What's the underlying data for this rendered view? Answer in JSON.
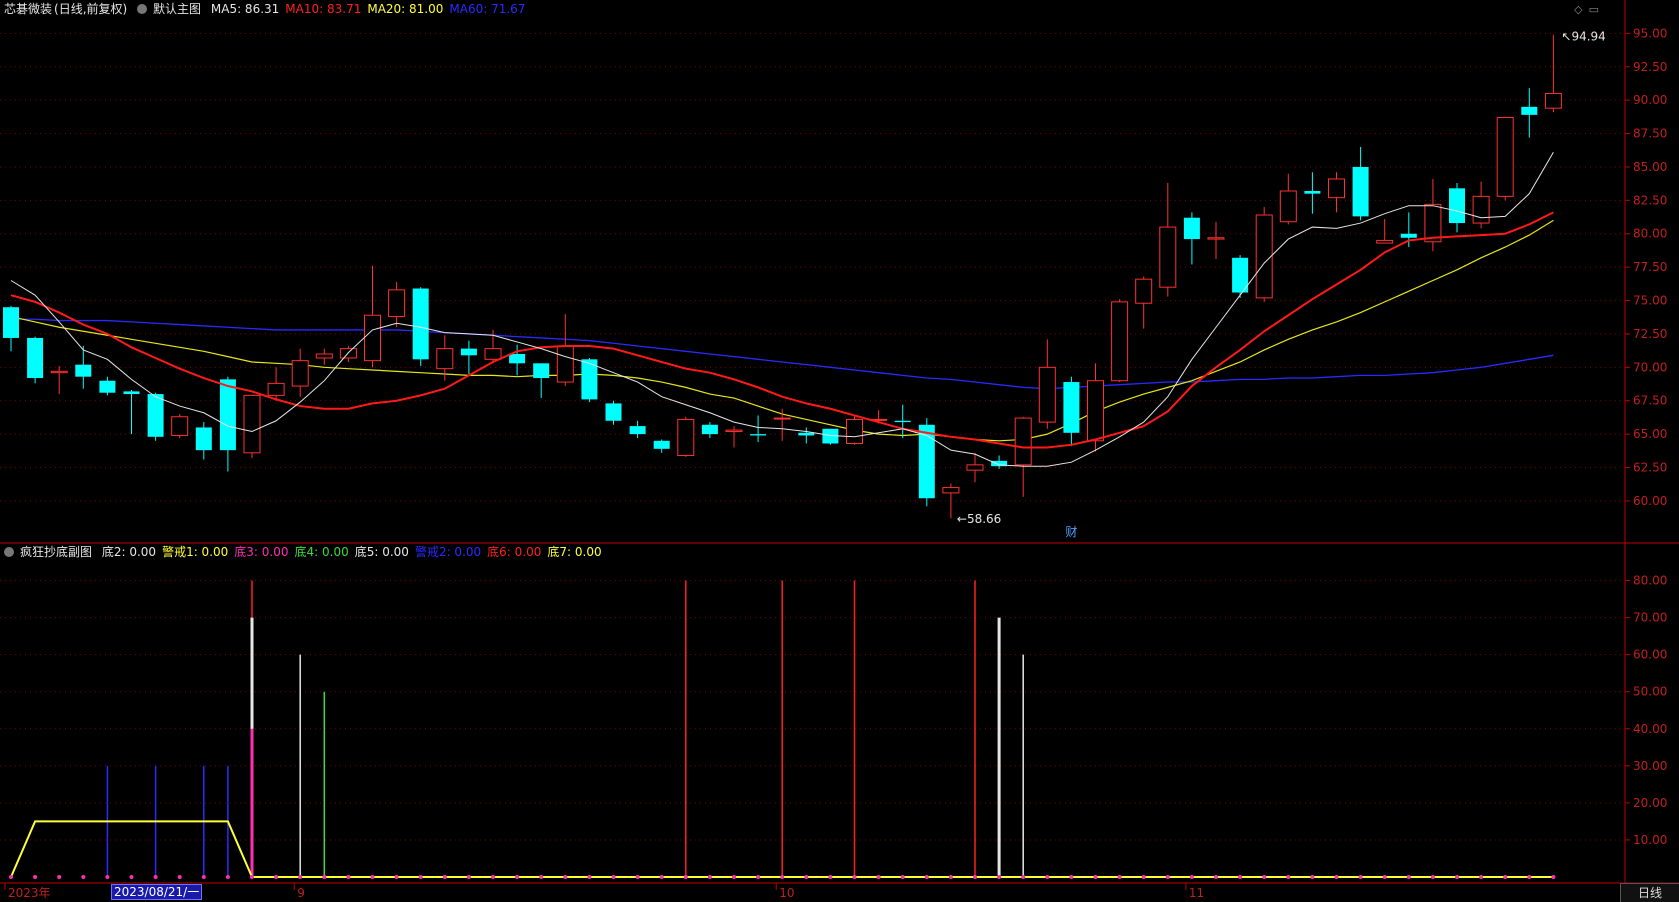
{
  "main_header": {
    "stock": "芯碁微装",
    "mode": "(日线,前复权)",
    "template": "默认主图",
    "ma_items": [
      {
        "label": "MA5: 86.31",
        "color": "#e6e6e6"
      },
      {
        "label": "MA10: 83.71",
        "color": "#ff2020"
      },
      {
        "label": "MA20: 81.00",
        "color": "#ffff3a"
      },
      {
        "label": "MA60: 71.67",
        "color": "#2a2aff"
      }
    ]
  },
  "sub_header": {
    "title": "疯狂抄底副图",
    "items": [
      {
        "label": "底2: 0.00",
        "color": "#e6e6e6"
      },
      {
        "label": "警戒1: 0.00",
        "color": "#ffff3a"
      },
      {
        "label": "底3: 0.00",
        "color": "#ff2fb4"
      },
      {
        "label": "底4: 0.00",
        "color": "#3adc3a"
      },
      {
        "label": "底5: 0.00",
        "color": "#e6e6e6"
      },
      {
        "label": "警戒2: 0.00",
        "color": "#2a2aff"
      },
      {
        "label": "底6: 0.00",
        "color": "#ff2020"
      },
      {
        "label": "底7: 0.00",
        "color": "#ffff3a"
      }
    ]
  },
  "annotations": {
    "high": "94.94",
    "low": "58.66",
    "marker": "财"
  },
  "x_axis": {
    "labels": [
      {
        "label": "2023年",
        "index": 0
      },
      {
        "label": "9",
        "index": 12
      },
      {
        "label": "10",
        "index": 32
      },
      {
        "label": "11",
        "index": 49
      }
    ],
    "cursor_date": "2023/08/21/一",
    "period": "日线"
  },
  "colors": {
    "up": "#ff3030",
    "down": "#00ffff",
    "axis": "#c00000",
    "grid": "#7a0000"
  },
  "chart_data": [
    {
      "type": "candlestick",
      "ylim": [
        57,
        96
      ],
      "yticks": [
        "95.00",
        "92.50",
        "90.00",
        "87.50",
        "85.00",
        "82.50",
        "80.00",
        "77.50",
        "75.00",
        "72.50",
        "70.00",
        "67.50",
        "65.00",
        "62.50",
        "60.00"
      ],
      "candles": [
        [
          74.5,
          72.2,
          74.6,
          71.2
        ],
        [
          72.2,
          69.2,
          72.3,
          68.8
        ],
        [
          69.6,
          69.7,
          70.1,
          68.0
        ],
        [
          70.2,
          69.3,
          71.6,
          68.4
        ],
        [
          69.0,
          68.1,
          69.3,
          67.9
        ],
        [
          68.2,
          68.0,
          68.3,
          65.0
        ],
        [
          68.0,
          64.8,
          68.1,
          64.5
        ],
        [
          64.9,
          66.3,
          66.5,
          64.7
        ],
        [
          65.5,
          63.8,
          65.9,
          63.1
        ],
        [
          69.1,
          63.8,
          69.3,
          62.2
        ],
        [
          63.6,
          67.9,
          67.9,
          63.2
        ],
        [
          67.9,
          68.8,
          70.0,
          67.5
        ],
        [
          68.6,
          70.5,
          71.4,
          67.8
        ],
        [
          70.7,
          71.0,
          71.4,
          70.2
        ],
        [
          70.7,
          71.4,
          71.6,
          70.4
        ],
        [
          70.5,
          73.9,
          77.6,
          70.0
        ],
        [
          73.8,
          75.8,
          76.4,
          73.0
        ],
        [
          75.9,
          70.6,
          76.0,
          70.1
        ],
        [
          69.9,
          71.4,
          72.4,
          69.0
        ],
        [
          71.4,
          70.9,
          72.0,
          69.5
        ],
        [
          70.6,
          71.4,
          72.8,
          70.3
        ],
        [
          71.0,
          70.3,
          71.7,
          69.4
        ],
        [
          70.3,
          69.2,
          70.3,
          67.7
        ],
        [
          68.9,
          71.6,
          74.0,
          68.6
        ],
        [
          70.6,
          67.6,
          70.7,
          67.4
        ],
        [
          67.3,
          66.0,
          67.5,
          65.7
        ],
        [
          65.6,
          65.0,
          66.0,
          64.7
        ],
        [
          64.5,
          63.9,
          64.6,
          63.6
        ],
        [
          63.4,
          66.1,
          66.3,
          63.3
        ],
        [
          65.7,
          65.0,
          65.9,
          64.7
        ],
        [
          65.2,
          65.3,
          65.6,
          64.0
        ],
        [
          65.0,
          64.9,
          66.4,
          64.4
        ],
        [
          66.2,
          66.2,
          66.9,
          64.5
        ],
        [
          65.1,
          64.9,
          65.5,
          64.3
        ],
        [
          65.4,
          64.3,
          65.4,
          64.2
        ],
        [
          64.3,
          66.1,
          66.4,
          64.2
        ],
        [
          66.1,
          66.1,
          66.8,
          65.8
        ],
        [
          66.0,
          65.9,
          67.2,
          64.7
        ],
        [
          65.7,
          60.2,
          66.2,
          59.6
        ],
        [
          60.6,
          61.0,
          61.3,
          58.7
        ],
        [
          62.3,
          62.7,
          63.6,
          61.4
        ],
        [
          63.0,
          62.6,
          63.4,
          62.4
        ],
        [
          62.7,
          66.2,
          66.3,
          60.3
        ],
        [
          65.9,
          70.0,
          72.1,
          65.4
        ],
        [
          68.9,
          65.1,
          69.3,
          64.1
        ],
        [
          64.5,
          69.0,
          70.3,
          63.7
        ],
        [
          69.0,
          74.9,
          75.1,
          68.9
        ],
        [
          74.8,
          76.6,
          76.8,
          72.9
        ],
        [
          76.0,
          80.5,
          83.8,
          75.3
        ],
        [
          81.2,
          79.6,
          81.6,
          77.7
        ],
        [
          79.6,
          79.7,
          80.9,
          78.1
        ],
        [
          78.2,
          75.6,
          78.4,
          75.2
        ],
        [
          75.2,
          81.4,
          82.0,
          74.9
        ],
        [
          80.9,
          83.2,
          84.5,
          80.7
        ],
        [
          83.2,
          83.0,
          84.6,
          81.5
        ],
        [
          82.7,
          84.1,
          84.6,
          81.6
        ],
        [
          85.0,
          81.3,
          86.5,
          81.0
        ],
        [
          79.3,
          79.5,
          81.1,
          79.3
        ],
        [
          80.0,
          79.7,
          81.6,
          79.0
        ],
        [
          79.4,
          82.2,
          84.1,
          78.7
        ],
        [
          83.4,
          80.8,
          83.8,
          80.1
        ],
        [
          80.8,
          82.8,
          83.9,
          80.4
        ],
        [
          82.8,
          88.7,
          88.7,
          82.5
        ],
        [
          89.5,
          88.9,
          90.9,
          87.2
        ],
        [
          89.4,
          90.5,
          94.9,
          89.1
        ]
      ],
      "ma5": [
        76.5,
        75.4,
        73.4,
        71.3,
        70.6,
        69.1,
        67.8,
        67.1,
        66.6,
        65.6,
        65.2,
        66.0,
        67.4,
        69.0,
        71.1,
        72.8,
        73.3,
        73.0,
        72.6,
        72.5,
        72.4,
        71.9,
        71.4,
        70.8,
        70.3,
        69.6,
        68.9,
        67.8,
        67.2,
        66.6,
        65.9,
        65.5,
        65.4,
        65.2,
        64.9,
        64.8,
        65.1,
        65.4,
        64.9,
        63.8,
        63.5,
        62.7,
        62.6,
        62.6,
        62.9,
        63.8,
        64.8,
        65.9,
        67.8,
        70.6,
        73.0,
        75.4,
        77.8,
        79.6,
        80.5,
        80.4,
        80.8,
        81.5,
        82.1,
        82.1,
        81.7,
        81.2,
        81.3,
        83.0,
        86.1
      ],
      "ma10": [
        75.4,
        74.9,
        74.1,
        73.2,
        72.5,
        71.5,
        70.7,
        69.9,
        69.2,
        68.6,
        68.2,
        67.6,
        67.1,
        66.9,
        66.9,
        67.3,
        67.5,
        67.9,
        68.4,
        69.4,
        70.4,
        71.2,
        71.5,
        71.6,
        71.6,
        71.4,
        70.9,
        70.4,
        69.9,
        69.6,
        69.1,
        68.5,
        67.8,
        67.3,
        66.9,
        66.4,
        65.9,
        65.4,
        65.1,
        64.8,
        64.6,
        64.3,
        64.0,
        64.0,
        64.2,
        64.6,
        65.1,
        65.6,
        66.7,
        68.6,
        70.0,
        71.3,
        72.7,
        73.9,
        75.1,
        76.2,
        77.3,
        78.6,
        79.5,
        79.7,
        79.8,
        79.9,
        80.0,
        80.7,
        81.6
      ],
      "ma20": [
        73.8,
        73.4,
        73.0,
        72.7,
        72.4,
        72.1,
        71.8,
        71.5,
        71.2,
        70.8,
        70.4,
        70.3,
        70.2,
        70.0,
        69.9,
        69.8,
        69.7,
        69.6,
        69.5,
        69.4,
        69.4,
        69.3,
        69.4,
        69.4,
        69.5,
        69.4,
        69.2,
        68.9,
        68.5,
        68.0,
        67.7,
        67.1,
        66.5,
        66.1,
        65.7,
        65.3,
        65.0,
        64.9,
        65.0,
        64.8,
        64.6,
        64.5,
        64.6,
        65.0,
        65.8,
        66.7,
        67.4,
        68.0,
        68.5,
        69.0,
        69.7,
        70.4,
        71.3,
        72.1,
        72.8,
        73.4,
        74.1,
        74.9,
        75.7,
        76.5,
        77.3,
        78.2,
        79.0,
        79.9,
        81.0
      ],
      "ma60": [
        73.6,
        73.6,
        73.5,
        73.5,
        73.5,
        73.4,
        73.3,
        73.2,
        73.1,
        73.0,
        72.9,
        72.8,
        72.8,
        72.8,
        72.8,
        72.8,
        72.8,
        72.7,
        72.6,
        72.5,
        72.4,
        72.3,
        72.2,
        72.1,
        72.0,
        71.8,
        71.6,
        71.4,
        71.2,
        71.0,
        70.8,
        70.6,
        70.4,
        70.2,
        70.0,
        69.8,
        69.6,
        69.4,
        69.2,
        69.1,
        68.9,
        68.7,
        68.5,
        68.4,
        68.5,
        68.6,
        68.7,
        68.8,
        68.9,
        68.9,
        69.0,
        69.1,
        69.1,
        69.2,
        69.2,
        69.3,
        69.4,
        69.4,
        69.5,
        69.6,
        69.8,
        70.0,
        70.3,
        70.6,
        70.9
      ]
    },
    {
      "type": "bar",
      "ylim": [
        0,
        85
      ],
      "yticks": [
        "80.00",
        "70.00",
        "60.00",
        "50.00",
        "40.00",
        "30.00",
        "20.00",
        "10.00"
      ],
      "bars": [
        {
          "index": 4,
          "value": 30,
          "color": "#2a2aff"
        },
        {
          "index": 6,
          "value": 30,
          "color": "#2a2aff"
        },
        {
          "index": 8,
          "value": 30,
          "color": "#2a2aff"
        },
        {
          "index": 9,
          "value": 30,
          "color": "#2a2aff"
        },
        {
          "index": 10,
          "value": 80,
          "color": "#ff2020"
        },
        {
          "index": 10,
          "value": 70,
          "color": "#e6e6e6"
        },
        {
          "index": 10,
          "value": 40,
          "color": "#ff2fb4"
        },
        {
          "index": 12,
          "value": 60,
          "color": "#e6e6e6"
        },
        {
          "index": 13,
          "value": 50,
          "color": "#3adc3a"
        },
        {
          "index": 28,
          "value": 80,
          "color": "#ff2020"
        },
        {
          "index": 32,
          "value": 80,
          "color": "#ff2020"
        },
        {
          "index": 35,
          "value": 80,
          "color": "#ff2020"
        },
        {
          "index": 40,
          "value": 80,
          "color": "#ff2020"
        },
        {
          "index": 41,
          "value": 70,
          "color": "#e6e6e6"
        },
        {
          "index": 42,
          "value": 60,
          "color": "#e6e6e6"
        }
      ],
      "warning_line": [
        0,
        15,
        15,
        15,
        15,
        15,
        15,
        15,
        15,
        15,
        0,
        0,
        0,
        0,
        0,
        0,
        0,
        0,
        0,
        0,
        0,
        0,
        0,
        0,
        0,
        0,
        0,
        0,
        0,
        0,
        0,
        0,
        0,
        0,
        0,
        0,
        0,
        0,
        0,
        0,
        0,
        0,
        0,
        0,
        0,
        0,
        0,
        0,
        0,
        0,
        0,
        0,
        0,
        0,
        0,
        0,
        0,
        0,
        0,
        0,
        0,
        0,
        0,
        0,
        0
      ]
    }
  ]
}
